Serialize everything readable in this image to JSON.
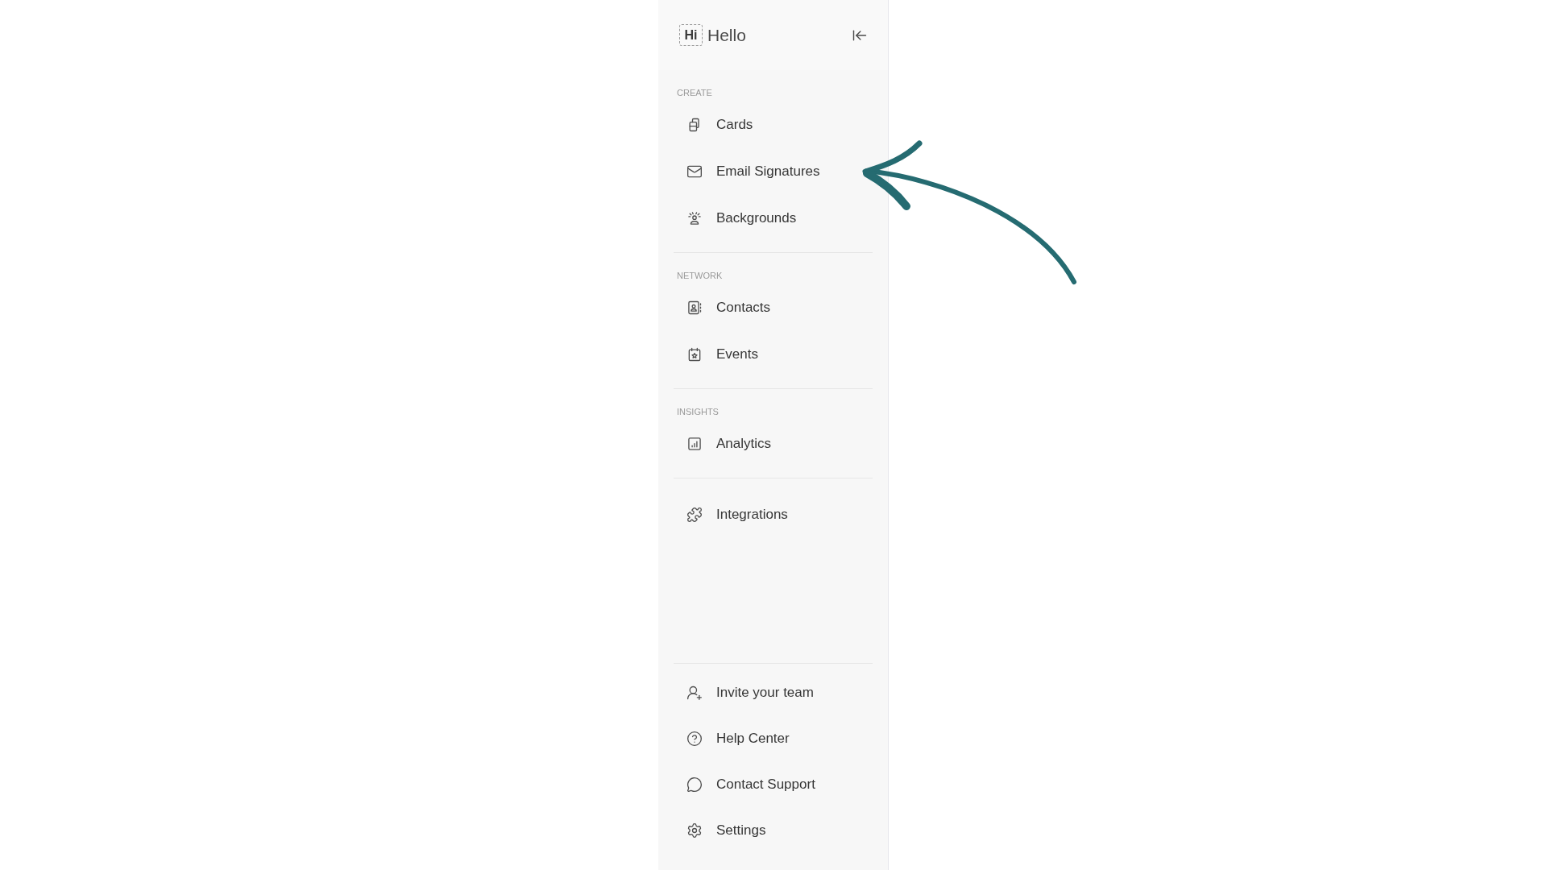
{
  "sidebar": {
    "logo": {
      "mark": "Hi",
      "name": "Hello"
    },
    "sections": [
      {
        "label": "CREATE",
        "items": [
          {
            "label": "Cards",
            "selected": false
          },
          {
            "label": "Email Signatures",
            "selected": false
          },
          {
            "label": "Backgrounds",
            "selected": false
          }
        ]
      },
      {
        "label": "NETWORK",
        "items": [
          {
            "label": "Contacts",
            "selected": false
          },
          {
            "label": "Events",
            "selected": false
          }
        ]
      },
      {
        "label": "INSIGHTS",
        "items": [
          {
            "label": "Analytics",
            "selected": false
          }
        ]
      },
      {
        "items": [
          {
            "label": "Integrations",
            "selected": false
          }
        ]
      }
    ],
    "footer_items": [
      {
        "label": "Invite your team",
        "selected": false
      },
      {
        "label": "Help Center",
        "selected": false
      },
      {
        "label": "Contact Support",
        "selected": false
      },
      {
        "label": "Settings",
        "selected": false
      }
    ]
  }
}
